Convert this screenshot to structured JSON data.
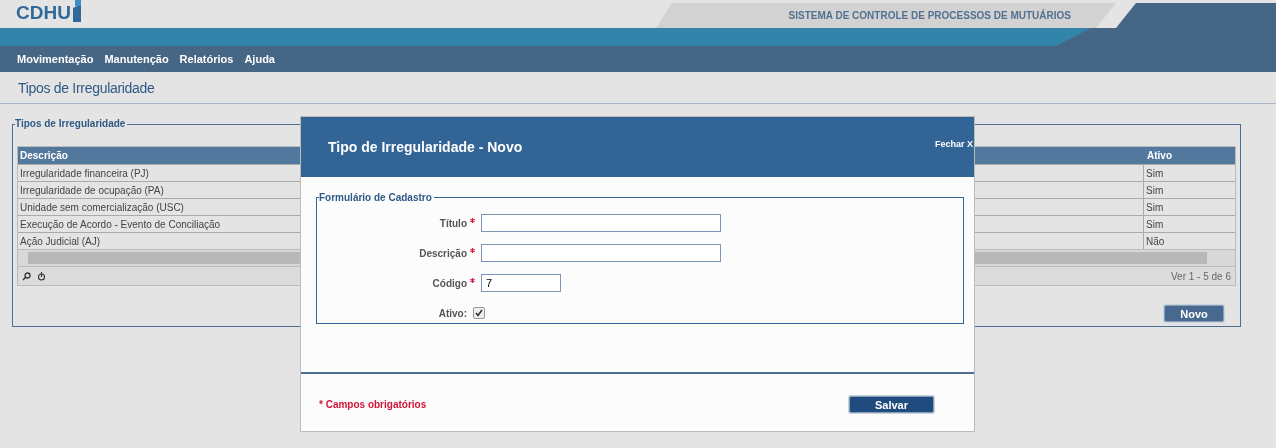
{
  "header": {
    "logo": "CDHU",
    "system_title": "SISTEMA DE CONTROLE DE PROCESSOS DE MUTUÁRIOS"
  },
  "menu": [
    "Movimentação",
    "Manutenção",
    "Relatórios",
    "Ajuda"
  ],
  "page_title": "Tipos de Irregularidade",
  "panel": {
    "legend": "Tipos de Irregularidade",
    "table": {
      "columns": [
        "Descrição",
        "Ativo"
      ],
      "rows": [
        [
          "Irregularidade financeira (PJ)",
          "Sim"
        ],
        [
          "Irregularidade de ocupação (PA)",
          "Sim"
        ],
        [
          "Unidade sem comercialização (USC)",
          "Sim"
        ],
        [
          "Execução de Acordo - Evento de Conciliação",
          "Sim"
        ],
        [
          "Ação Judicial (AJ)",
          "Não"
        ]
      ]
    },
    "pager": "Ver 1 - 5 de 6",
    "button": "Novo"
  },
  "modal": {
    "title": "Tipo de Irregularidade - Novo",
    "close": "Fechar X",
    "legend": "Formulário de Cadastro",
    "fields": [
      {
        "kind": "text",
        "label": "Título",
        "required": true
      },
      {
        "kind": "text",
        "label": "Descrição",
        "required": true
      },
      {
        "kind": "short",
        "label": "Código",
        "required": true,
        "value": "7"
      },
      {
        "kind": "checkbox",
        "label": "Ativo:",
        "required": false,
        "checked": true
      }
    ],
    "note": "* Campos obrigatórios",
    "button": "Salvar"
  }
}
